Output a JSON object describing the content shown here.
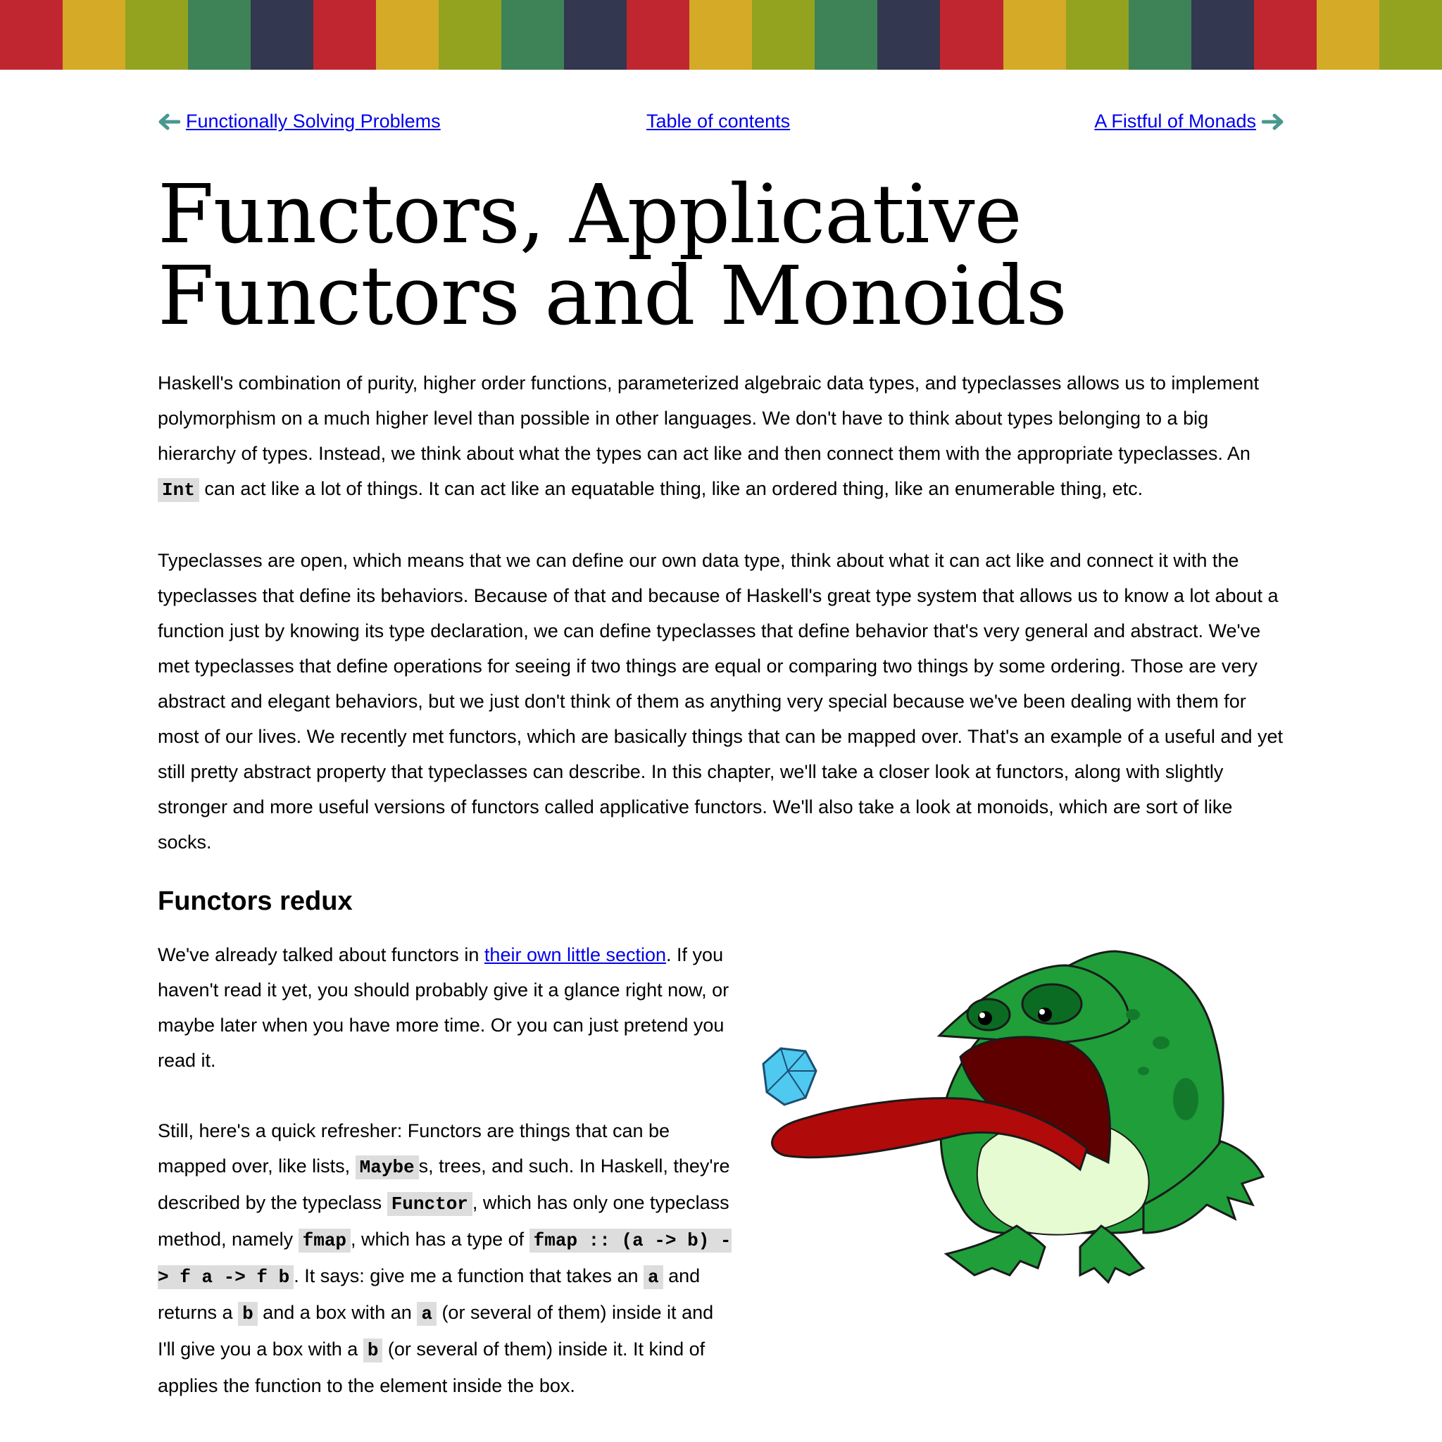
{
  "stripe_colors": [
    "#c0262f",
    "#d4aa27",
    "#93a31f",
    "#3d8357",
    "#33374f",
    "#c0262f",
    "#d4aa27",
    "#93a31f",
    "#3d8357",
    "#33374f",
    "#c0262f",
    "#d4aa27",
    "#93a31f",
    "#3d8357",
    "#33374f",
    "#c0262f",
    "#d4aa27",
    "#93a31f",
    "#3d8357",
    "#33374f",
    "#c0262f",
    "#d4aa27",
    "#93a31f"
  ],
  "nav": {
    "prev_label": "Functionally Solving Problems",
    "toc_label": "Table of contents",
    "next_label": "A Fistful of Monads"
  },
  "title": {
    "line1": "Functors, Applicative",
    "line2": "Functors and Monoids"
  },
  "intro": {
    "p1_a": "Haskell's combination of purity, higher order functions, parameterized algebraic data types, and typeclasses allows us to implement polymorphism on a much higher level than possible in other languages. We don't have to think about types belonging to a big hierarchy of types. Instead, we think about what the types can act like and then connect them with the appropriate typeclasses. An ",
    "p1_code": "Int",
    "p1_b": " can act like a lot of things. It can act like an equatable thing, like an ordered thing, like an enumerable thing, etc.",
    "p2": "Typeclasses are open, which means that we can define our own data type, think about what it can act like and connect it with the typeclasses that define its behaviors. Because of that and because of Haskell's great type system that allows us to know a lot about a function just by knowing its type declaration, we can define typeclasses that define behavior that's very general and abstract. We've met typeclasses that define operations for seeing if two things are equal or comparing two things by some ordering. Those are very abstract and elegant behaviors, but we just don't think of them as anything very special because we've been dealing with them for most of our lives. We recently met functors, which are basically things that can be mapped over. That's an example of a useful and yet still pretty abstract property that typeclasses can describe. In this chapter, we'll take a closer look at functors, along with slightly stronger and more useful versions of functors called applicative functors. We'll also take a look at monoids, which are sort of like socks."
  },
  "section": {
    "heading": "Functors redux",
    "p3_a": "We've already talked about functors in ",
    "p3_link": "their own little section",
    "p3_b": ". If you haven't read it yet, you should probably give it a glance right now, or maybe later when you have more time. Or you can just pretend you read it.",
    "p4_a": "Still, here's a quick refresher: Functors are things that can be mapped over, like lists, ",
    "p4_code1": "Maybe",
    "p4_b": "s, trees, and such. In Haskell, they're described by the typeclass ",
    "p4_code2": "Functor",
    "p4_c": ", which has only one typeclass method, namely ",
    "p4_code3": "fmap",
    "p4_d": ", which has a type of ",
    "p4_code4": "fmap :: (a -> b) -> f a -> f b",
    "p4_e": ". It says: give me a function that takes an ",
    "p4_code5": "a",
    "p4_f": " and returns a ",
    "p4_code6": "b",
    "p4_g": " and a box with an ",
    "p4_code7": "a",
    "p4_h": " (or several of them) inside it and I'll give you a box with a ",
    "p4_code8": "b",
    "p4_i": " (or several of them) inside it. It kind of applies the function to the element inside the box."
  }
}
